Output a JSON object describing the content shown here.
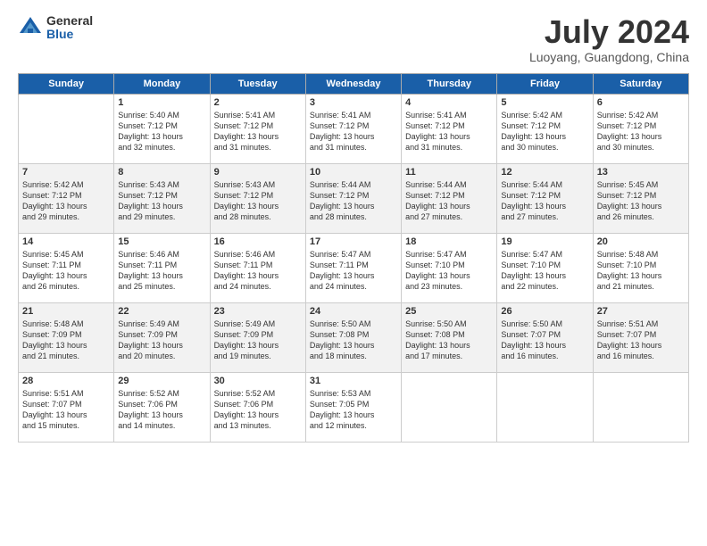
{
  "header": {
    "logo": {
      "general": "General",
      "blue": "Blue"
    },
    "title": "July 2024",
    "location": "Luoyang, Guangdong, China"
  },
  "days_of_week": [
    "Sunday",
    "Monday",
    "Tuesday",
    "Wednesday",
    "Thursday",
    "Friday",
    "Saturday"
  ],
  "weeks": [
    [
      {
        "day": "",
        "info": ""
      },
      {
        "day": "1",
        "info": "Sunrise: 5:40 AM\nSunset: 7:12 PM\nDaylight: 13 hours\nand 32 minutes."
      },
      {
        "day": "2",
        "info": "Sunrise: 5:41 AM\nSunset: 7:12 PM\nDaylight: 13 hours\nand 31 minutes."
      },
      {
        "day": "3",
        "info": "Sunrise: 5:41 AM\nSunset: 7:12 PM\nDaylight: 13 hours\nand 31 minutes."
      },
      {
        "day": "4",
        "info": "Sunrise: 5:41 AM\nSunset: 7:12 PM\nDaylight: 13 hours\nand 31 minutes."
      },
      {
        "day": "5",
        "info": "Sunrise: 5:42 AM\nSunset: 7:12 PM\nDaylight: 13 hours\nand 30 minutes."
      },
      {
        "day": "6",
        "info": "Sunrise: 5:42 AM\nSunset: 7:12 PM\nDaylight: 13 hours\nand 30 minutes."
      }
    ],
    [
      {
        "day": "7",
        "info": "Sunrise: 5:42 AM\nSunset: 7:12 PM\nDaylight: 13 hours\nand 29 minutes."
      },
      {
        "day": "8",
        "info": "Sunrise: 5:43 AM\nSunset: 7:12 PM\nDaylight: 13 hours\nand 29 minutes."
      },
      {
        "day": "9",
        "info": "Sunrise: 5:43 AM\nSunset: 7:12 PM\nDaylight: 13 hours\nand 28 minutes."
      },
      {
        "day": "10",
        "info": "Sunrise: 5:44 AM\nSunset: 7:12 PM\nDaylight: 13 hours\nand 28 minutes."
      },
      {
        "day": "11",
        "info": "Sunrise: 5:44 AM\nSunset: 7:12 PM\nDaylight: 13 hours\nand 27 minutes."
      },
      {
        "day": "12",
        "info": "Sunrise: 5:44 AM\nSunset: 7:12 PM\nDaylight: 13 hours\nand 27 minutes."
      },
      {
        "day": "13",
        "info": "Sunrise: 5:45 AM\nSunset: 7:12 PM\nDaylight: 13 hours\nand 26 minutes."
      }
    ],
    [
      {
        "day": "14",
        "info": "Sunrise: 5:45 AM\nSunset: 7:11 PM\nDaylight: 13 hours\nand 26 minutes."
      },
      {
        "day": "15",
        "info": "Sunrise: 5:46 AM\nSunset: 7:11 PM\nDaylight: 13 hours\nand 25 minutes."
      },
      {
        "day": "16",
        "info": "Sunrise: 5:46 AM\nSunset: 7:11 PM\nDaylight: 13 hours\nand 24 minutes."
      },
      {
        "day": "17",
        "info": "Sunrise: 5:47 AM\nSunset: 7:11 PM\nDaylight: 13 hours\nand 24 minutes."
      },
      {
        "day": "18",
        "info": "Sunrise: 5:47 AM\nSunset: 7:10 PM\nDaylight: 13 hours\nand 23 minutes."
      },
      {
        "day": "19",
        "info": "Sunrise: 5:47 AM\nSunset: 7:10 PM\nDaylight: 13 hours\nand 22 minutes."
      },
      {
        "day": "20",
        "info": "Sunrise: 5:48 AM\nSunset: 7:10 PM\nDaylight: 13 hours\nand 21 minutes."
      }
    ],
    [
      {
        "day": "21",
        "info": "Sunrise: 5:48 AM\nSunset: 7:09 PM\nDaylight: 13 hours\nand 21 minutes."
      },
      {
        "day": "22",
        "info": "Sunrise: 5:49 AM\nSunset: 7:09 PM\nDaylight: 13 hours\nand 20 minutes."
      },
      {
        "day": "23",
        "info": "Sunrise: 5:49 AM\nSunset: 7:09 PM\nDaylight: 13 hours\nand 19 minutes."
      },
      {
        "day": "24",
        "info": "Sunrise: 5:50 AM\nSunset: 7:08 PM\nDaylight: 13 hours\nand 18 minutes."
      },
      {
        "day": "25",
        "info": "Sunrise: 5:50 AM\nSunset: 7:08 PM\nDaylight: 13 hours\nand 17 minutes."
      },
      {
        "day": "26",
        "info": "Sunrise: 5:50 AM\nSunset: 7:07 PM\nDaylight: 13 hours\nand 16 minutes."
      },
      {
        "day": "27",
        "info": "Sunrise: 5:51 AM\nSunset: 7:07 PM\nDaylight: 13 hours\nand 16 minutes."
      }
    ],
    [
      {
        "day": "28",
        "info": "Sunrise: 5:51 AM\nSunset: 7:07 PM\nDaylight: 13 hours\nand 15 minutes."
      },
      {
        "day": "29",
        "info": "Sunrise: 5:52 AM\nSunset: 7:06 PM\nDaylight: 13 hours\nand 14 minutes."
      },
      {
        "day": "30",
        "info": "Sunrise: 5:52 AM\nSunset: 7:06 PM\nDaylight: 13 hours\nand 13 minutes."
      },
      {
        "day": "31",
        "info": "Sunrise: 5:53 AM\nSunset: 7:05 PM\nDaylight: 13 hours\nand 12 minutes."
      },
      {
        "day": "",
        "info": ""
      },
      {
        "day": "",
        "info": ""
      },
      {
        "day": "",
        "info": ""
      }
    ]
  ]
}
